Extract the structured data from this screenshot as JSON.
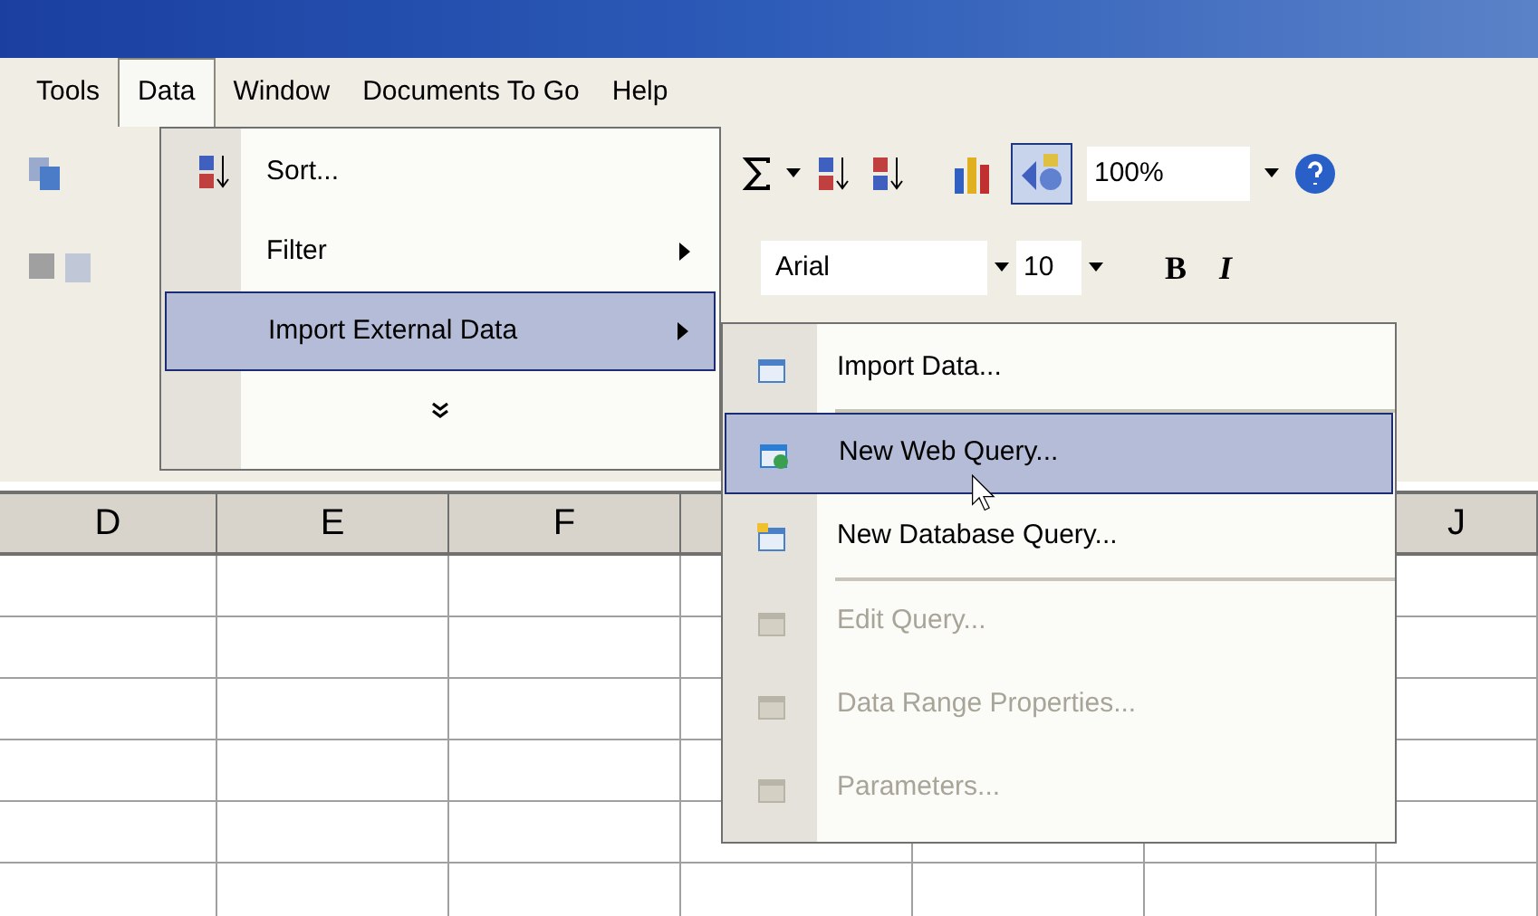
{
  "menu_bar": [
    {
      "label": "Tools",
      "selected": false
    },
    {
      "label": "Data",
      "selected": true
    },
    {
      "label": "Window",
      "selected": false
    },
    {
      "label": "Documents To Go",
      "selected": false
    },
    {
      "label": "Help",
      "selected": false
    }
  ],
  "toolbar": {
    "zoom": "100%",
    "font": "Arial",
    "font_size": "10",
    "bold": "B",
    "italic": "I"
  },
  "data_menu": [
    {
      "kind": "icon",
      "label": "Sort...",
      "submenu": false,
      "selected": false
    },
    {
      "kind": "plain",
      "label": "Filter",
      "submenu": true,
      "selected": false
    },
    {
      "kind": "plain",
      "label": "Import External Data",
      "submenu": true,
      "selected": true
    },
    {
      "kind": "expand",
      "submenu": false,
      "selected": false
    }
  ],
  "import_submenu": [
    {
      "label": "Import Data...",
      "selected": false,
      "disabled": false,
      "separator_after": true
    },
    {
      "label": "New Web Query...",
      "selected": true,
      "disabled": false,
      "separator_after": false
    },
    {
      "label": "New Database Query...",
      "selected": false,
      "disabled": false,
      "separator_after": true
    },
    {
      "label": "Edit Query...",
      "selected": false,
      "disabled": true,
      "separator_after": false
    },
    {
      "label": "Data Range Properties...",
      "selected": false,
      "disabled": true,
      "separator_after": false
    },
    {
      "label": "Parameters...",
      "selected": false,
      "disabled": true,
      "separator_after": false
    }
  ],
  "sheet": {
    "columns": [
      "D",
      "E",
      "F",
      "",
      "",
      "",
      "J"
    ]
  }
}
